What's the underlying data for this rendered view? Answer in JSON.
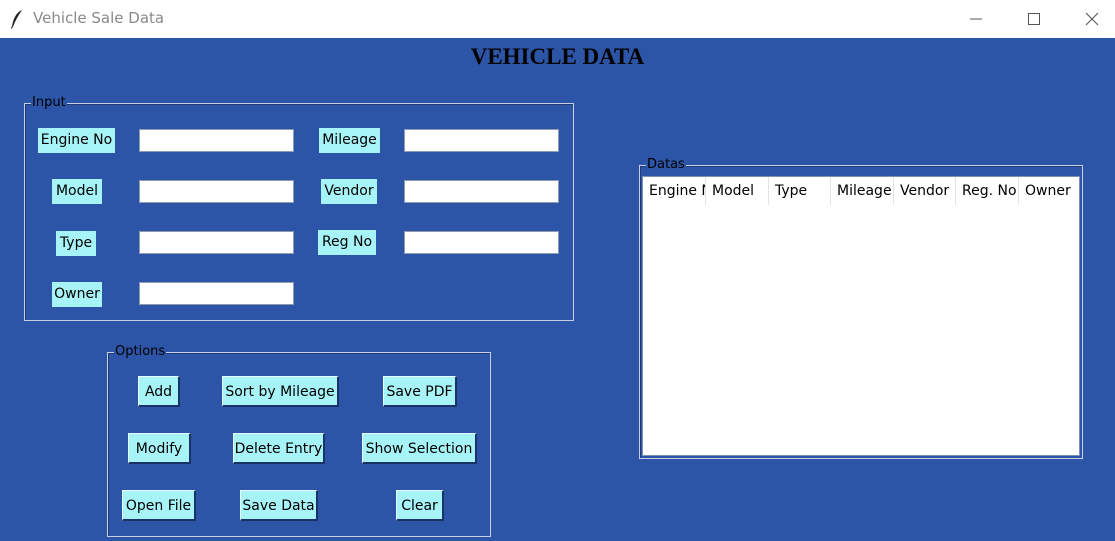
{
  "window": {
    "title": "Vehicle Sale Data",
    "icon": "feather-icon"
  },
  "heading": "VEHICLE DATA",
  "input_frame": {
    "label": "Input",
    "fields": {
      "engine_no": {
        "label": "Engine No",
        "value": ""
      },
      "model": {
        "label": "Model",
        "value": ""
      },
      "type": {
        "label": "Type",
        "value": ""
      },
      "owner": {
        "label": "Owner",
        "value": ""
      },
      "mileage": {
        "label": "Mileage",
        "value": ""
      },
      "vendor": {
        "label": "Vendor",
        "value": ""
      },
      "reg_no": {
        "label": "Reg No",
        "value": ""
      }
    }
  },
  "options_frame": {
    "label": "Options",
    "buttons": {
      "add": "Add",
      "sort_by_mileage": "Sort by Mileage",
      "save_pdf": "Save PDF",
      "modify": "Modify",
      "delete_entry": "Delete Entry",
      "show_selection": "Show Selection",
      "open_file": "Open File",
      "save_data": "Save Data",
      "clear": "Clear"
    }
  },
  "datas_frame": {
    "label": "Datas",
    "columns": [
      "Engine No",
      "Model",
      "Type",
      "Mileage",
      "Vendor",
      "Reg. No",
      "Owner"
    ],
    "rows": []
  },
  "colors": {
    "background": "#2c55a8",
    "label_bg": "#a6f3f8",
    "button_bg": "#a6f3f8"
  }
}
